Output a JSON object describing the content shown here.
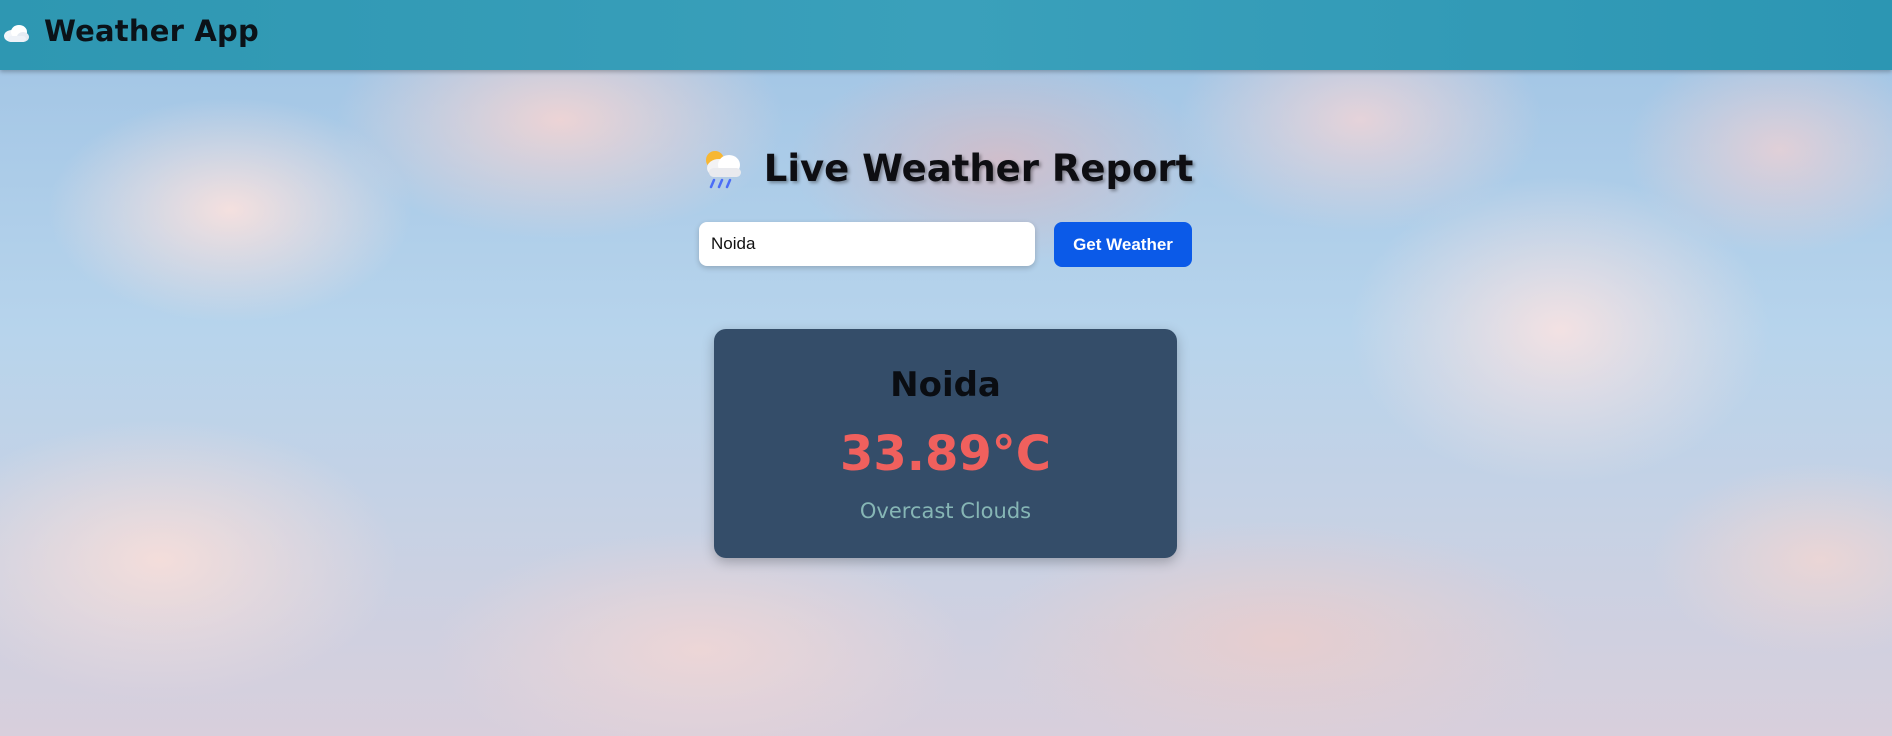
{
  "navbar": {
    "icon": "cloud-icon",
    "title": "Weather App"
  },
  "main": {
    "heading_icon": "cloud-rain-sun-icon",
    "heading": "Live Weather Report",
    "search": {
      "value": "Noida"
    },
    "button_label": "Get Weather",
    "result": {
      "city": "Noida",
      "temperature": "33.89°C",
      "description": "Overcast Clouds"
    }
  },
  "colors": {
    "navbar": "#2e97b2",
    "button": "#0b5ae8",
    "card": "#344d69",
    "temperature": "#f0605d",
    "description": "#86b6b5"
  }
}
